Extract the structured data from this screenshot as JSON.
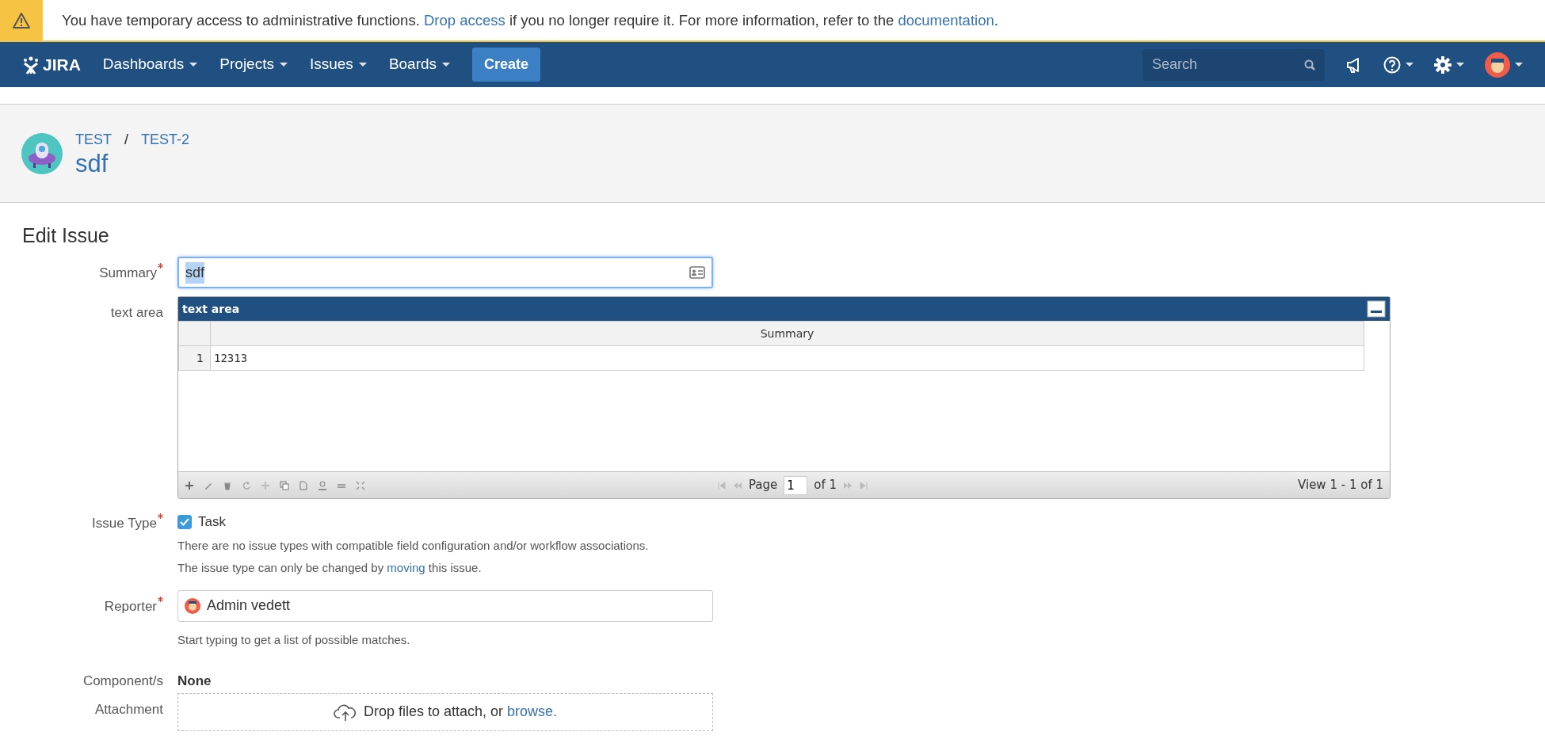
{
  "banner": {
    "text_before": "You have temporary access to administrative functions.",
    "link": "Drop access",
    "text_middle": "if you no longer require it. For more information, refer to the",
    "link2": "documentation",
    "text_after": "."
  },
  "navbar": {
    "logo": "JIRA",
    "menus": [
      "Dashboards",
      "Projects",
      "Issues",
      "Boards"
    ],
    "create": "Create",
    "search": {
      "placeholder": "Search"
    }
  },
  "header": {
    "breadcrumbs": [
      "TEST",
      "TEST-2"
    ],
    "separator": "/",
    "title": "sdf"
  },
  "form": {
    "heading": "Edit Issue",
    "summary": {
      "label": "Summary",
      "required": true,
      "value": "sdf"
    },
    "text_area": {
      "label": "text area",
      "grid": {
        "caption": "text area",
        "columns": [
          "Summary"
        ],
        "rows": [
          {
            "number": "1",
            "cells": [
              "12313"
            ]
          }
        ],
        "pager": {
          "page_label": "Page",
          "page": "1",
          "of": "of 1"
        },
        "view": "View 1 - 1 of 1"
      }
    },
    "issue_type": {
      "label": "Issue Type",
      "required": true,
      "value": "Task",
      "checked": true,
      "notes": [
        "There are no issue types with compatible field configuration and/or workflow associations."
      ],
      "move_note": {
        "before": "The issue type can only be changed by",
        "link": "moving",
        "after": "this issue."
      }
    },
    "reporter": {
      "label": "Reporter",
      "required": true,
      "value": "Admin vedett",
      "hint": "Start typing to get a list of possible matches."
    },
    "components": {
      "label": "Component/s",
      "value": "None"
    },
    "attachment": {
      "label": "Attachment",
      "text": "Drop files to attach, or",
      "link": "browse."
    }
  }
}
